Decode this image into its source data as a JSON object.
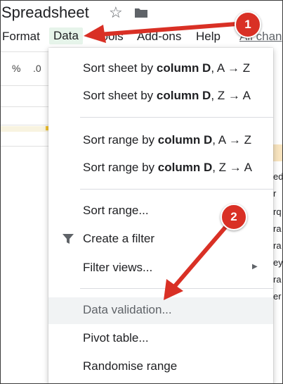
{
  "app": {
    "title": "Spreadsheet"
  },
  "menubar": {
    "items": [
      {
        "label": "Format"
      },
      {
        "label": "Data"
      },
      {
        "label": "Tools"
      },
      {
        "label": "Add-ons"
      },
      {
        "label": "Help"
      }
    ],
    "changes_link": "All chan"
  },
  "toolbar": {
    "percent": "%",
    "decimal": ".0"
  },
  "right_cells": [
    "ed",
    "r",
    "rq",
    "ra",
    "ra",
    "ey",
    "ra",
    "er"
  ],
  "dropdown": {
    "items": [
      {
        "prefix": "Sort sheet by ",
        "bold": "column D",
        "suffix": ", A → Z"
      },
      {
        "prefix": "Sort sheet by ",
        "bold": "column D",
        "suffix": ", Z → A"
      },
      {
        "prefix": "Sort range by ",
        "bold": "column D",
        "suffix": ", A → Z"
      },
      {
        "prefix": "Sort range by ",
        "bold": "column D",
        "suffix": ", Z → A"
      },
      {
        "label": "Sort range..."
      },
      {
        "label": "Create a filter"
      },
      {
        "label": "Filter views..."
      },
      {
        "label": "Data validation..."
      },
      {
        "label": "Pivot table..."
      },
      {
        "label": "Randomise range"
      }
    ]
  },
  "annotations": {
    "badge1": "1",
    "badge2": "2",
    "accent": "#d93025"
  }
}
